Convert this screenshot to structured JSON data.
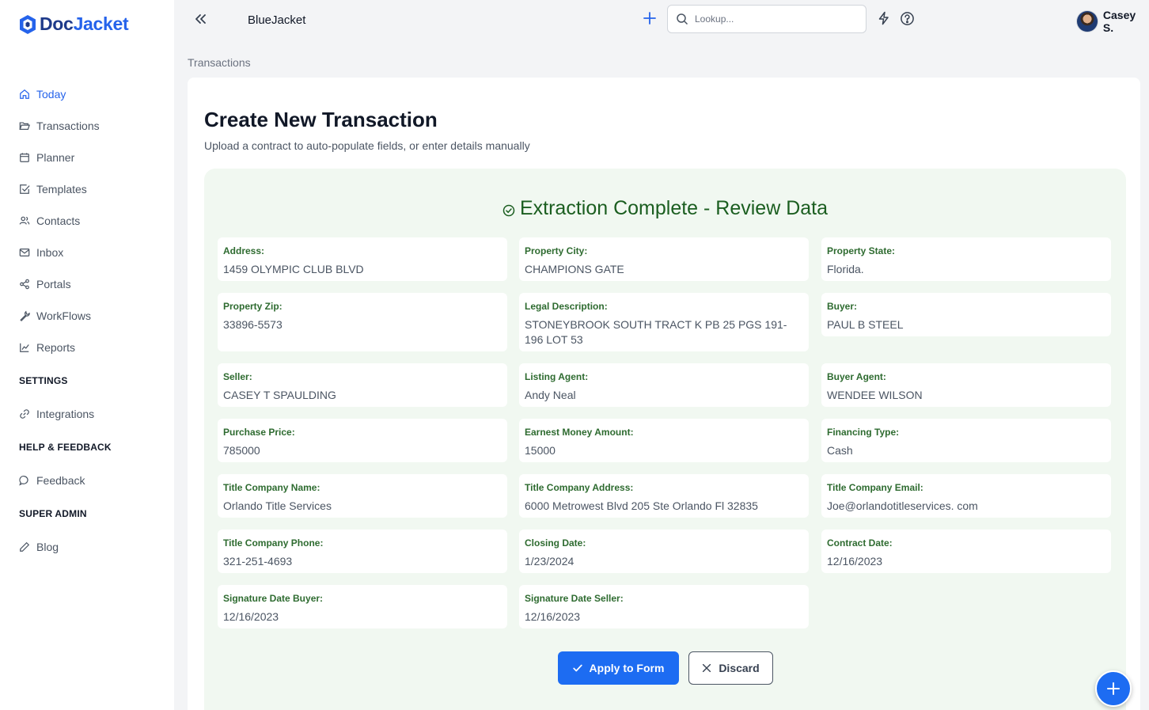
{
  "app": {
    "logo_part1": "Doc",
    "logo_part2": "Jacket",
    "brand_color": "#1e3a8a",
    "accent_color": "#2563eb"
  },
  "sidebar": {
    "items": [
      {
        "label": "Today",
        "icon": "home-icon",
        "active": true
      },
      {
        "label": "Transactions",
        "icon": "folder-open-icon"
      },
      {
        "label": "Planner",
        "icon": "calendar-icon"
      },
      {
        "label": "Templates",
        "icon": "check-square-icon"
      },
      {
        "label": "Contacts",
        "icon": "users-icon"
      },
      {
        "label": "Inbox",
        "icon": "mail-icon"
      },
      {
        "label": "Portals",
        "icon": "share-icon"
      },
      {
        "label": "WorkFlows",
        "icon": "wrench-icon"
      },
      {
        "label": "Reports",
        "icon": "chart-icon"
      }
    ],
    "settings_heading": "SETTINGS",
    "settings_items": [
      {
        "label": "Integrations",
        "icon": "link-icon"
      }
    ],
    "help_heading": "HELP & FEEDBACK",
    "help_items": [
      {
        "label": "Feedback",
        "icon": "message-icon"
      }
    ],
    "admin_heading": "SUPER ADMIN",
    "admin_items": [
      {
        "label": "Blog",
        "icon": "pencil-icon"
      }
    ]
  },
  "header": {
    "workspace": "BlueJacket",
    "search_placeholder": "Lookup...",
    "user_name": "Casey S."
  },
  "breadcrumb": "Transactions",
  "page": {
    "title": "Create New Transaction",
    "subtitle": "Upload a contract to auto-populate fields, or enter details manually"
  },
  "review": {
    "title": "Extraction Complete - Review Data",
    "fields": [
      {
        "label": "Address:",
        "value": "1459 OLYMPIC CLUB BLVD"
      },
      {
        "label": "Property City:",
        "value": "CHAMPIONS GATE"
      },
      {
        "label": "Property State:",
        "value": "Florida."
      },
      {
        "label": "Property Zip:",
        "value": "33896-5573"
      },
      {
        "label": "Legal Description:",
        "value": "STONEYBROOK SOUTH TRACT K PB 25 PGS 191-196 LOT 53"
      },
      {
        "label": "Buyer:",
        "value": "PAUL B STEEL"
      },
      {
        "label": "Seller:",
        "value": "CASEY T SPAULDING"
      },
      {
        "label": "Listing Agent:",
        "value": "Andy Neal"
      },
      {
        "label": "Buyer Agent:",
        "value": "WENDEE WILSON"
      },
      {
        "label": "Purchase Price:",
        "value": "785000"
      },
      {
        "label": "Earnest Money Amount:",
        "value": "15000"
      },
      {
        "label": "Financing Type:",
        "value": "Cash"
      },
      {
        "label": "Title Company Name:",
        "value": "Orlando Title Services"
      },
      {
        "label": "Title Company Address:",
        "value": "6000 Metrowest Blvd 205 Ste Orlando Fl 32835"
      },
      {
        "label": "Title Company Email:",
        "value": "Joe@orlandotitleservices. com"
      },
      {
        "label": "Title Company Phone:",
        "value": "321-251-4693"
      },
      {
        "label": "Closing Date:",
        "value": "1/23/2024"
      },
      {
        "label": "Contract Date:",
        "value": "12/16/2023"
      },
      {
        "label": "Signature Date Buyer:",
        "value": "12/16/2023"
      },
      {
        "label": "Signature Date Seller:",
        "value": "12/16/2023"
      }
    ],
    "apply_label": "Apply to Form",
    "discard_label": "Discard"
  }
}
